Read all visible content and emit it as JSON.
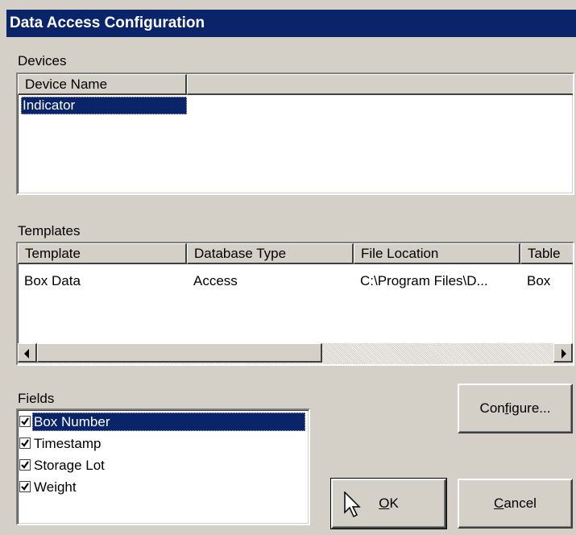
{
  "window": {
    "title": "Data Access Configuration"
  },
  "devices": {
    "group_label": "Devices",
    "columns": [
      "Device Name",
      ""
    ],
    "rows": [
      {
        "device_name": "Indicator",
        "selected": true
      }
    ]
  },
  "templates": {
    "group_label": "Templates",
    "columns": [
      "Template",
      "Database Type",
      "File Location",
      "Table"
    ],
    "rows": [
      {
        "template": "Box Data",
        "database_type": "Access",
        "file_location": "C:\\Program Files\\D...",
        "table": "Box"
      }
    ]
  },
  "fields": {
    "group_label": "Fields",
    "items": [
      {
        "label": "Box Number",
        "checked": true,
        "selected": true
      },
      {
        "label": "Timestamp",
        "checked": true,
        "selected": false
      },
      {
        "label": "Storage Lot",
        "checked": true,
        "selected": false
      },
      {
        "label": "Weight",
        "checked": true,
        "selected": false
      }
    ]
  },
  "buttons": {
    "configure_pre": "Con",
    "configure_mn": "f",
    "configure_post": "igure...",
    "ok_mn": "O",
    "ok_post": "K",
    "cancel_mn": "C",
    "cancel_post": "ancel"
  },
  "colors": {
    "titlebar": "#0a246a",
    "face": "#d4d0c8",
    "selection": "#0a246a"
  }
}
